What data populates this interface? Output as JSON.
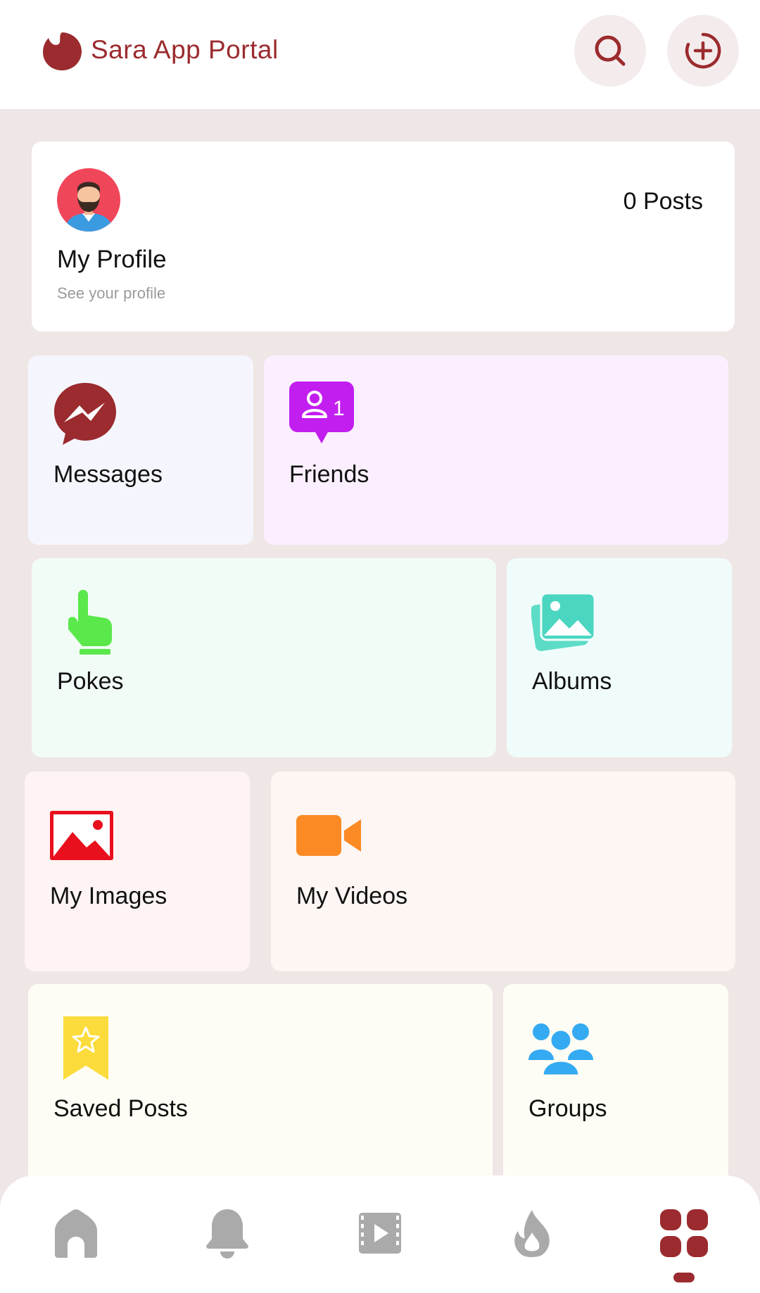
{
  "header": {
    "app_title": "Sara App Portal",
    "brand_color": "#9b2b2e",
    "search_icon": "search-icon",
    "add_icon": "add-circle-icon"
  },
  "profile": {
    "name": "My Profile",
    "subtitle": "See your profile",
    "posts": "0 Posts"
  },
  "tiles": {
    "messages": "Messages",
    "friends": "Friends",
    "friends_badge": "1",
    "pokes": "Pokes",
    "albums": "Albums",
    "my_images": "My Images",
    "my_videos": "My Videos",
    "saved_posts": "Saved Posts",
    "groups": "Groups"
  },
  "nav": {
    "items": [
      "home-icon",
      "bell-icon",
      "video-icon",
      "fire-icon",
      "grid-icon"
    ],
    "active": "grid-icon"
  }
}
